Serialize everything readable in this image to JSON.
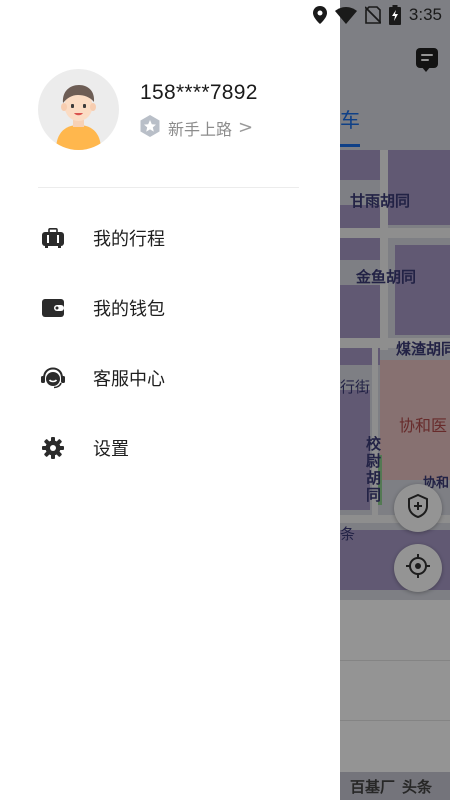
{
  "status_bar": {
    "time": "3:35",
    "icons": [
      "location-icon",
      "wifi-icon",
      "no-sim-icon",
      "battery-charging-icon"
    ]
  },
  "drawer": {
    "profile": {
      "phone": "158****7892",
      "level_text": "新手上路",
      "level_chevron": ">"
    },
    "menu": [
      {
        "label": "我的行程",
        "icon": "trip-luggage-icon"
      },
      {
        "label": "我的钱包",
        "icon": "wallet-icon"
      },
      {
        "label": "客服中心",
        "icon": "customer-service-icon"
      },
      {
        "label": "设置",
        "icon": "gear-icon"
      }
    ]
  },
  "background_map": {
    "tab_label": "车",
    "accent_color": "#1b6ee8",
    "street_labels": [
      "甘雨胡同",
      "金鱼胡同",
      "煤渣胡同",
      "行街",
      "协和医",
      "校尉胡同",
      "协和",
      "条",
      "百基厂",
      "头条"
    ],
    "icons": [
      "message-icon",
      "safety-shield-icon",
      "locate-icon"
    ]
  },
  "colors": {
    "scrim": "rgba(0,0,0,0.42)",
    "drawer_bg": "#ffffff",
    "avatar_shirt": "#ffb74d"
  }
}
